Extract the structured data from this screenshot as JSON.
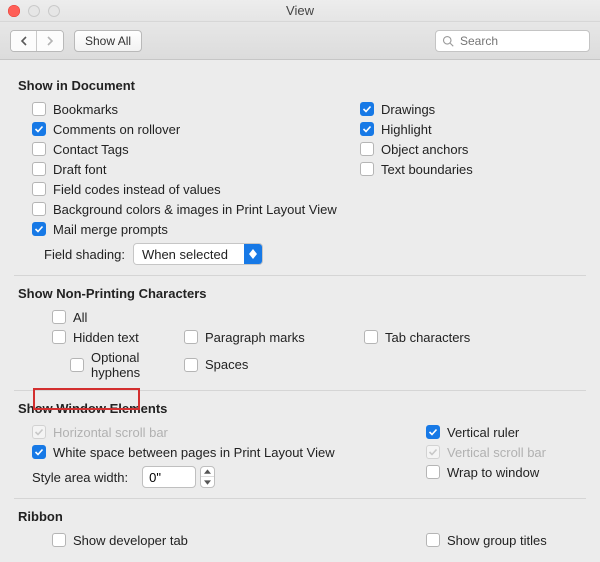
{
  "window": {
    "title": "View"
  },
  "toolbar": {
    "show_all": "Show All"
  },
  "search": {
    "placeholder": "Search"
  },
  "sections": {
    "show_in_document": {
      "title": "Show in Document",
      "left": [
        {
          "label": "Bookmarks",
          "checked": false
        },
        {
          "label": "Comments on rollover",
          "checked": true
        },
        {
          "label": "Contact Tags",
          "checked": false
        },
        {
          "label": "Draft font",
          "checked": false
        },
        {
          "label": "Field codes instead of values",
          "checked": false
        },
        {
          "label": "Background colors & images in Print Layout View",
          "checked": false
        },
        {
          "label": "Mail merge prompts",
          "checked": true
        }
      ],
      "right": [
        {
          "label": "Drawings",
          "checked": true
        },
        {
          "label": "Highlight",
          "checked": true
        },
        {
          "label": "Object anchors",
          "checked": false
        },
        {
          "label": "Text boundaries",
          "checked": false
        }
      ],
      "field_shading_label": "Field shading:",
      "field_shading_value": "When selected"
    },
    "nonprinting": {
      "title": "Show Non-Printing Characters",
      "all": {
        "label": "All",
        "checked": false
      },
      "row": [
        {
          "label": "Hidden text",
          "checked": false
        },
        {
          "label": "Paragraph marks",
          "checked": false
        },
        {
          "label": "Tab characters",
          "checked": false
        }
      ],
      "row2": [
        {
          "label": "Optional hyphens",
          "checked": false
        },
        {
          "label": "Spaces",
          "checked": false
        }
      ]
    },
    "window_elements": {
      "title": "Show Window Elements",
      "left": [
        {
          "label": "Horizontal scroll bar",
          "checked": true,
          "disabled": true
        },
        {
          "label": "White space between pages in Print Layout View",
          "checked": true
        }
      ],
      "right": [
        {
          "label": "Vertical ruler",
          "checked": true
        },
        {
          "label": "Vertical scroll bar",
          "checked": true,
          "disabled": true
        },
        {
          "label": "Wrap to window",
          "checked": false
        }
      ],
      "style_area_label": "Style area width:",
      "style_area_value": "0\""
    },
    "ribbon": {
      "title": "Ribbon",
      "left": {
        "label": "Show developer tab",
        "checked": false
      },
      "right": {
        "label": "Show group titles",
        "checked": false
      }
    }
  }
}
